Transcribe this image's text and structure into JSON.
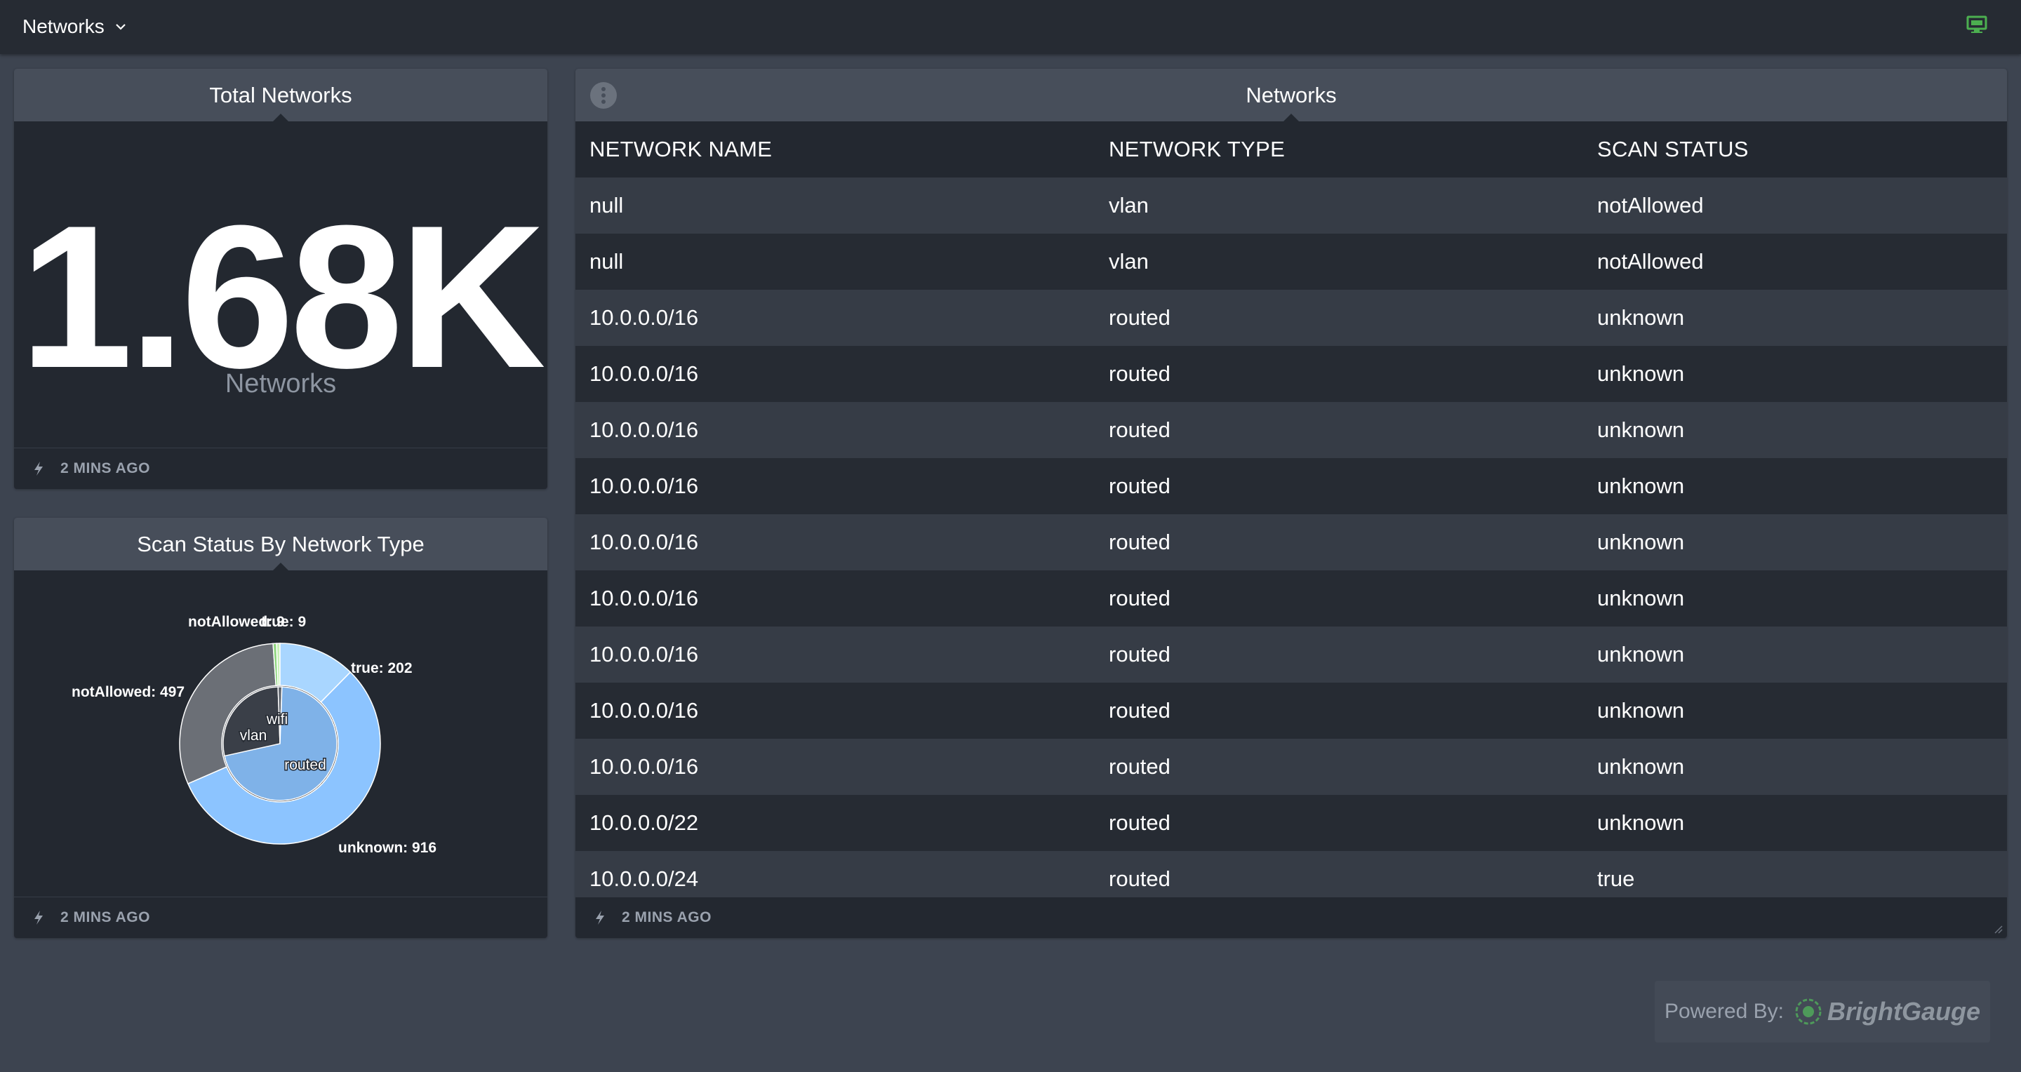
{
  "topbar": {
    "dashboard_title": "Networks",
    "monitor_icon": "monitor-icon",
    "monitor_color": "#4caf50"
  },
  "total_networks": {
    "title": "Total Networks",
    "value": "1.68K",
    "label": "Networks",
    "updated": "2 MINS AGO"
  },
  "scan_status": {
    "title": "Scan Status By Network Type",
    "updated": "2 MINS AGO"
  },
  "networks_table": {
    "title": "Networks",
    "columns": [
      "NETWORK NAME",
      "NETWORK TYPE",
      "SCAN STATUS"
    ],
    "rows": [
      [
        "null",
        "vlan",
        "notAllowed"
      ],
      [
        "null",
        "vlan",
        "notAllowed"
      ],
      [
        "10.0.0.0/16",
        "routed",
        "unknown"
      ],
      [
        "10.0.0.0/16",
        "routed",
        "unknown"
      ],
      [
        "10.0.0.0/16",
        "routed",
        "unknown"
      ],
      [
        "10.0.0.0/16",
        "routed",
        "unknown"
      ],
      [
        "10.0.0.0/16",
        "routed",
        "unknown"
      ],
      [
        "10.0.0.0/16",
        "routed",
        "unknown"
      ],
      [
        "10.0.0.0/16",
        "routed",
        "unknown"
      ],
      [
        "10.0.0.0/16",
        "routed",
        "unknown"
      ],
      [
        "10.0.0.0/16",
        "routed",
        "unknown"
      ],
      [
        "10.0.0.0/22",
        "routed",
        "unknown"
      ],
      [
        "10.0.0.0/24",
        "routed",
        "true"
      ]
    ],
    "updated": "2 MINS AGO"
  },
  "powered_by": {
    "label": "Powered By:",
    "brand": "BrightGauge"
  },
  "chart_data": {
    "type": "pie",
    "inner": [
      {
        "name": "vlan",
        "value": 506,
        "color": "#3a3f48"
      },
      {
        "name": "wifi",
        "value": 18,
        "color": "#5d636c"
      },
      {
        "name": "routed",
        "value": 1159,
        "color": "#7fb2e8"
      }
    ],
    "outer": [
      {
        "name": "notAllowed",
        "label": "notAllowed: 497",
        "value": 497,
        "color": "#6b6f76"
      },
      {
        "name": "notAllowed",
        "label": "notAllowed: 9",
        "value": 9,
        "color": "#8fd67f"
      },
      {
        "name": "true",
        "label": "true: 9",
        "value": 9,
        "color": "#c7f1b6"
      },
      {
        "name": "true",
        "label": "true: 202",
        "value": 202,
        "color": "#a9d6ff"
      },
      {
        "name": "unknown",
        "label": "unknown: 916",
        "value": 916,
        "color": "#8cc4ff"
      }
    ]
  }
}
